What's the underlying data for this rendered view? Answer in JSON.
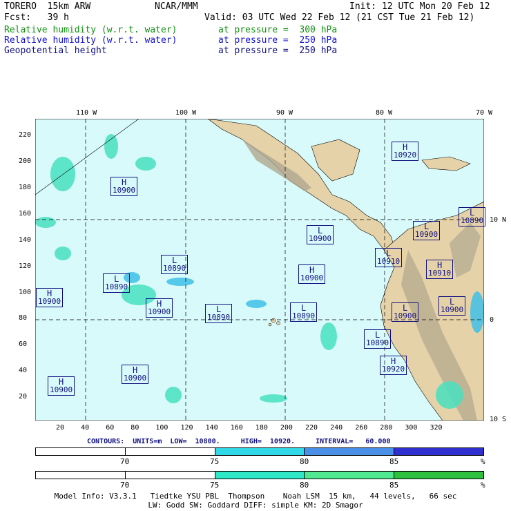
{
  "header": {
    "title_left": "TORERO  15km ARW",
    "title_mid": "NCAR/MMM",
    "init": "Init: 12 UTC Mon 20 Feb 12",
    "fcst": "Fcst:   39 h",
    "valid": "Valid: 03 UTC Wed 22 Feb 12 (21 CST Tue 21 Feb 12)",
    "fields": [
      {
        "name": "Relative humidity (w.r.t. water)",
        "level": "at pressure =  300 hPa",
        "color": "#109010"
      },
      {
        "name": "Relative humidity (w.r.t. water)",
        "level": "at pressure =  250 hPa",
        "color": "#1010d0"
      },
      {
        "name": "Geopotential height",
        "level": "at pressure =  250 hPa",
        "color": "#101080"
      }
    ]
  },
  "map": {
    "lon_labels": [
      "110 W",
      "100 W",
      "90 W",
      "80 W",
      "70 W"
    ],
    "lat_labels": [
      "10 N",
      "0",
      "10 S"
    ],
    "x_ticks": [
      "20",
      "40",
      "60",
      "80",
      "100",
      "120",
      "140",
      "160",
      "180",
      "200",
      "220",
      "240",
      "260",
      "280",
      "300",
      "320"
    ],
    "y_ticks": [
      "20",
      "40",
      "60",
      "80",
      "100",
      "120",
      "140",
      "160",
      "180",
      "200",
      "220"
    ],
    "ocean_color": "#d8fafa",
    "land_color": "#e0c8a0",
    "terrain_dark": "#9a9280",
    "systems": [
      {
        "type": "H",
        "value": "10920"
      },
      {
        "type": "H",
        "value": "10900"
      },
      {
        "type": "L",
        "value": "10900"
      },
      {
        "type": "L",
        "value": "10900"
      },
      {
        "type": "L",
        "value": "10890"
      },
      {
        "type": "L",
        "value": "10910"
      },
      {
        "type": "H",
        "value": "10900"
      },
      {
        "type": "H",
        "value": "10910"
      },
      {
        "type": "L",
        "value": "10890"
      },
      {
        "type": "H",
        "value": "10900"
      },
      {
        "type": "H",
        "value": "10900"
      },
      {
        "type": "L",
        "value": "10890"
      },
      {
        "type": "L",
        "value": "10890"
      },
      {
        "type": "L",
        "value": "10900"
      },
      {
        "type": "L",
        "value": "10900"
      },
      {
        "type": "L",
        "value": "10890"
      },
      {
        "type": "H",
        "value": "10920"
      },
      {
        "type": "H",
        "value": "10900"
      },
      {
        "type": "H",
        "value": "10900"
      },
      {
        "type": "L",
        "value": "10890"
      }
    ]
  },
  "contours": {
    "units_label": "CONTOURS:  UNITS=m  LOW=  10800.     HIGH=  10920.     INTERVAL=   60.000"
  },
  "colorbars": [
    {
      "labels": [
        "70",
        "75",
        "80",
        "85"
      ],
      "unit": "%",
      "colors": [
        "#ffffff",
        "#30d8e8",
        "#4a90e8",
        "#3030d0"
      ]
    },
    {
      "labels": [
        "70",
        "75",
        "80",
        "85"
      ],
      "unit": "%",
      "colors": [
        "#ffffff",
        "#30e8c8",
        "#50e890",
        "#30c040"
      ]
    }
  ],
  "footer": {
    "line1": "Model Info: V3.3.1   Tiedtke YSU PBL  Thompson    Noah LSM  15 km,   44 levels,   66 sec",
    "line2": "LW: Godd SW: Goddard DIFF: simple KM: 2D Smagor"
  }
}
